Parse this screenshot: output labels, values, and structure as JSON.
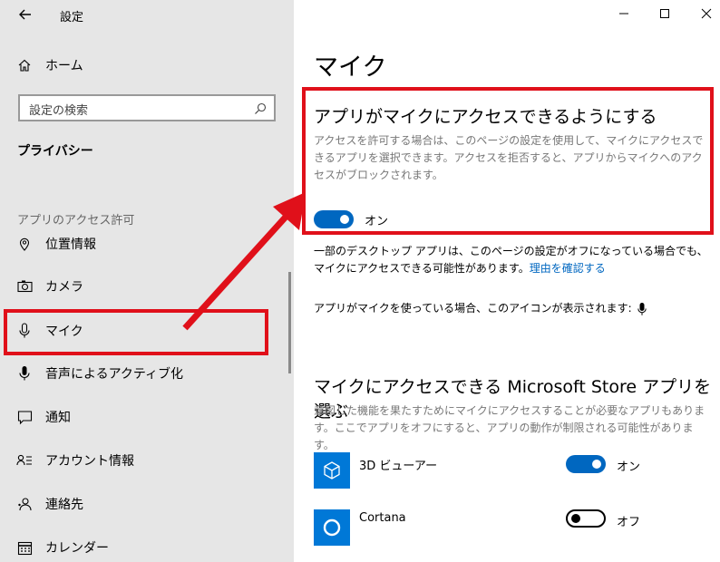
{
  "window": {
    "title": "設定"
  },
  "sidebar": {
    "home_label": "ホーム",
    "search_placeholder": "設定の検索",
    "section_title": "プライバシー",
    "group_label": "アプリのアクセス許可",
    "items": [
      {
        "label": "位置情報",
        "icon": "location-icon"
      },
      {
        "label": "カメラ",
        "icon": "camera-icon"
      },
      {
        "label": "マイク",
        "icon": "microphone-icon",
        "selected": true
      },
      {
        "label": "音声によるアクティブ化",
        "icon": "voice-activation-icon"
      },
      {
        "label": "通知",
        "icon": "notification-icon"
      },
      {
        "label": "アカウント情報",
        "icon": "account-info-icon"
      },
      {
        "label": "連絡先",
        "icon": "contacts-icon"
      },
      {
        "label": "カレンダー",
        "icon": "calendar-icon"
      }
    ]
  },
  "main": {
    "page_title": "マイク",
    "access_heading": "アプリがマイクにアクセスできるようにする",
    "access_desc": "アクセスを許可する場合は、このページの設定を使用して、マイクにアクセスできるアプリを選択できます。アクセスを拒否すると、アプリからマイクへのアクセスがブロックされます。",
    "access_toggle": {
      "state": "on",
      "label": "オン"
    },
    "desktop_note": "一部のデスクトップ アプリは、このページの設定がオフになっている場合でも、マイクにアクセスできる可能性があります。",
    "desktop_link": "理由を確認する",
    "icon_note": "アプリがマイクを使っている場合、このアイコンが表示されます:",
    "store_heading": "マイクにアクセスできる Microsoft Store アプリを選ぶ",
    "store_desc": "意図した機能を果たすためにマイクにアクセスすることが必要なアプリもあります。ここでアプリをオフにすると、アプリの動作が制限される可能性があります。",
    "apps": [
      {
        "name": "3D ビューアー",
        "state": "on",
        "toggle_label": "オン",
        "icon": "3d-viewer-icon"
      },
      {
        "name": "Cortana",
        "state": "off",
        "toggle_label": "オフ",
        "icon": "cortana-icon"
      }
    ]
  },
  "annotation": {
    "color": "#e0101a"
  }
}
